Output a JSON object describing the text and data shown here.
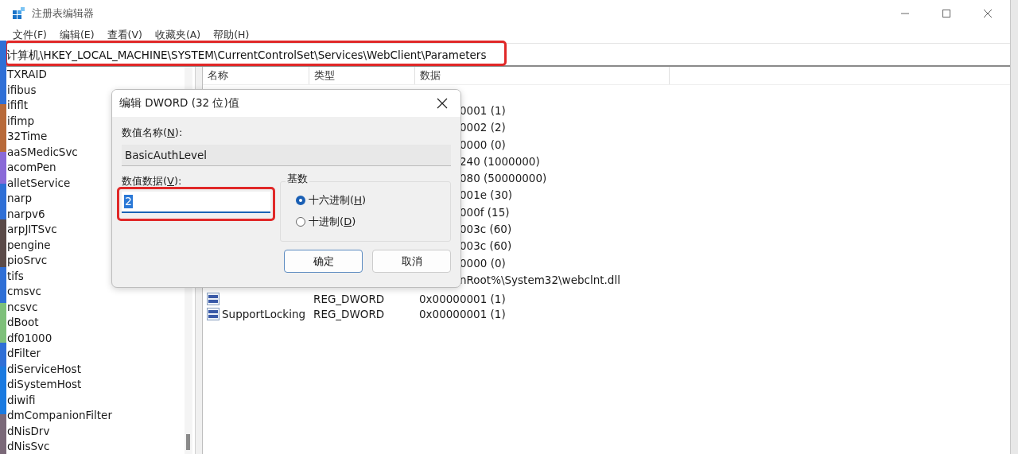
{
  "window": {
    "title": "注册表编辑器"
  },
  "menu": [
    "文件(F)",
    "编辑(E)",
    "查看(V)",
    "收藏夹(A)",
    "帮助(H)"
  ],
  "address_bar": {
    "value": "计算机\\HKEY_LOCAL_MACHINE\\SYSTEM\\CurrentControlSet\\Services\\WebClient\\Parameters",
    "highlighted": true
  },
  "tree": {
    "items": [
      {
        "label": "TXRAID"
      },
      {
        "label": "ifibus"
      },
      {
        "label": "ififlt"
      },
      {
        "label": "ifimp"
      },
      {
        "label": "32Time"
      },
      {
        "label": "aaSMedicSvc"
      },
      {
        "label": "acomPen"
      },
      {
        "label": "alletService"
      },
      {
        "label": "narp"
      },
      {
        "label": "narpv6"
      },
      {
        "label": "arpJITSvc"
      },
      {
        "label": "pengine"
      },
      {
        "label": "pioSrvc"
      },
      {
        "label": "tifs"
      },
      {
        "label": "cmsvc"
      },
      {
        "label": "ncsvc"
      },
      {
        "label": "dBoot"
      },
      {
        "label": "df01000"
      },
      {
        "label": "dFilter"
      },
      {
        "label": "diServiceHost"
      },
      {
        "label": "diSystemHost"
      },
      {
        "label": "diwifi"
      },
      {
        "label": "dmCompanionFilter"
      },
      {
        "label": "dNisDrv"
      },
      {
        "label": "dNisSvc"
      }
    ]
  },
  "values": {
    "columns": [
      "名称",
      "类型",
      "数据"
    ],
    "rows": [
      {
        "data": ""
      },
      {
        "data": "0001 (1)"
      },
      {
        "data": "0002 (2)"
      },
      {
        "data": "0000 (0)"
      },
      {
        "data": "240 (1000000)"
      },
      {
        "data": "080 (50000000)"
      },
      {
        "data": "001e (30)"
      },
      {
        "data": "000f (15)"
      },
      {
        "data": "003c (60)"
      },
      {
        "data": "003c (60)"
      },
      {
        "data": "0000 (0)"
      },
      {
        "data": "nRoot%\\System32\\webclnt.dll"
      },
      {
        "type": "REG_DWORD",
        "data": "0x00000001 (1)",
        "kind": "dword"
      },
      {
        "name": "SupportLocking",
        "type": "REG_DWORD",
        "data": "0x00000001 (1)",
        "kind": "dword"
      }
    ]
  },
  "dialog": {
    "title": "编辑 DWORD (32 位)值",
    "name_label": {
      "before": "数值名称(",
      "key": "N",
      "after": "):"
    },
    "name_value": "BasicAuthLevel",
    "data_label": {
      "before": "数值数据(",
      "key": "V",
      "after": "):"
    },
    "data_value": "2",
    "data_highlighted": true,
    "base_label": "基数",
    "base_options": [
      {
        "before": "十六进制(",
        "key": "H",
        "after": ")",
        "selected": true
      },
      {
        "before": "十进制(",
        "key": "D",
        "after": ")",
        "selected": false
      }
    ],
    "buttons": [
      {
        "label": "确定",
        "default": true
      },
      {
        "label": "取消",
        "default": false
      }
    ]
  }
}
